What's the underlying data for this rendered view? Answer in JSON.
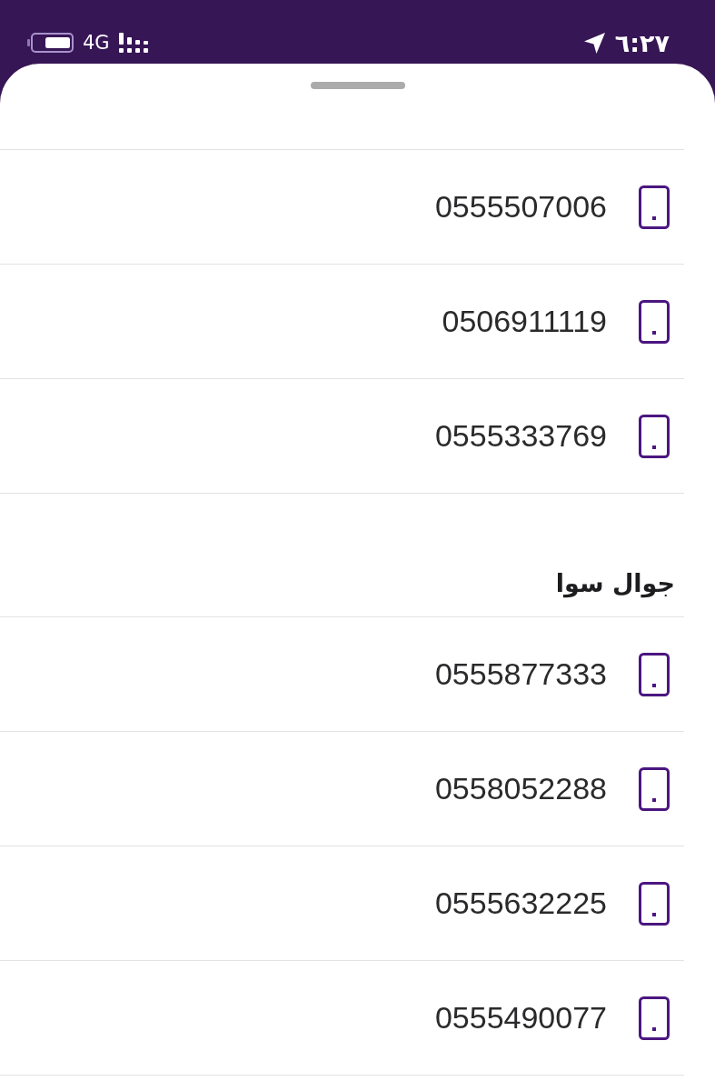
{
  "status_bar": {
    "time": "٦:٢٧",
    "network": "4G"
  },
  "sections": [
    {
      "rows": [
        {
          "number": "0555507006"
        },
        {
          "number": "0506911119"
        },
        {
          "number": "0555333769"
        }
      ]
    },
    {
      "title": "جوال سوا",
      "rows": [
        {
          "number": "0555877333"
        },
        {
          "number": "0558052288"
        },
        {
          "number": "0555632225"
        },
        {
          "number": "0555490077"
        }
      ]
    }
  ]
}
